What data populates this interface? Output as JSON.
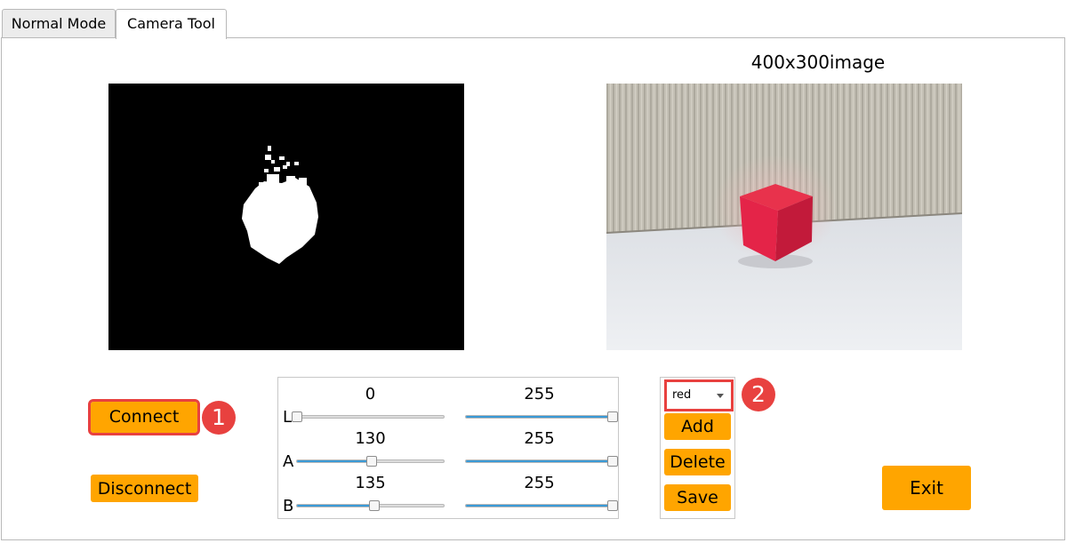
{
  "tabs": [
    {
      "label": "Normal Mode",
      "active": false
    },
    {
      "label": "Camera Tool",
      "active": true
    }
  ],
  "image_title": "400x300image",
  "buttons": {
    "connect": "Connect",
    "disconnect": "Disconnect",
    "add": "Add",
    "delete": "Delete",
    "save": "Save",
    "exit": "Exit"
  },
  "badges": {
    "one": "1",
    "two": "2"
  },
  "sliders": {
    "range_max": 255,
    "rows": [
      {
        "label": "L",
        "min_value": "0",
        "max_value": "255",
        "min": 0,
        "max": 255
      },
      {
        "label": "A",
        "min_value": "130",
        "max_value": "255",
        "min": 130,
        "max": 255
      },
      {
        "label": "B",
        "min_value": "135",
        "max_value": "255",
        "min": 135,
        "max": 255
      }
    ]
  },
  "color_select": {
    "value": "red"
  },
  "colors": {
    "accent": "#ffa500",
    "highlight": "#e8413f",
    "slider_fill": "#3a9ad6"
  },
  "icons": [
    "chevron-down-icon"
  ]
}
